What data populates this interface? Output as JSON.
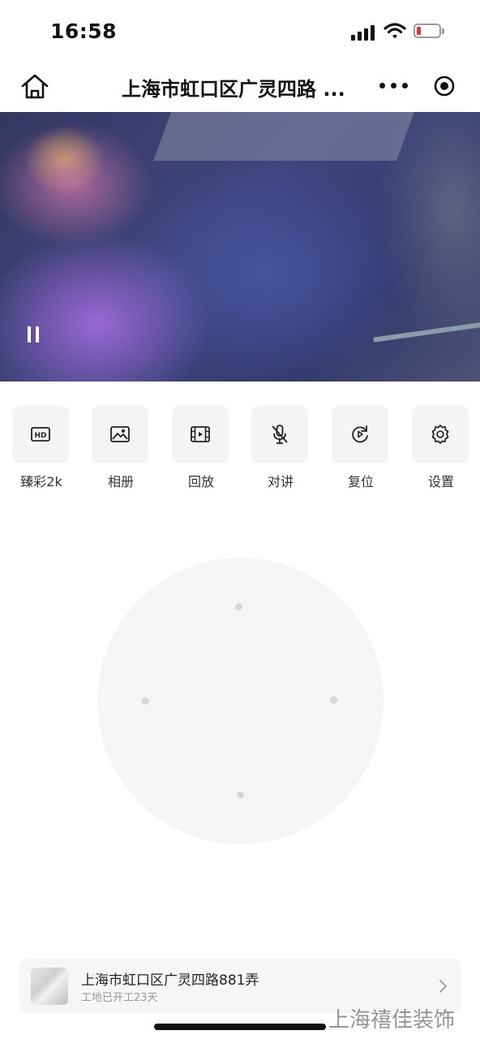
{
  "status_bar": {
    "time": "16:58",
    "icons": [
      "signal-icon",
      "wifi-icon",
      "battery-low-icon"
    ],
    "battery_color": "#e0363b"
  },
  "nav": {
    "title": "上海市虹口区广灵四路 ...",
    "icons": [
      "home-icon",
      "more-icon",
      "close-target-icon"
    ]
  },
  "video": {
    "paused": true,
    "icon": "pause-icon"
  },
  "toolbar": {
    "items": [
      {
        "label": "臻彩2k",
        "icon": "hd-icon"
      },
      {
        "label": "相册",
        "icon": "image-icon"
      },
      {
        "label": "回放",
        "icon": "film-icon"
      },
      {
        "label": "对讲",
        "icon": "mic-off-icon"
      },
      {
        "label": "复位",
        "icon": "reset-icon"
      },
      {
        "label": "设置",
        "icon": "gear-icon"
      }
    ]
  },
  "ptz": {
    "directions": [
      "up",
      "left",
      "right",
      "down"
    ]
  },
  "site": {
    "name": "上海市虹口区广灵四路881弄",
    "subtitle": "工地已开工23天",
    "icon": "chevron-right-icon"
  },
  "watermark": "上海禧佳装饰",
  "colors": {
    "background": "#ffffff",
    "button_bg": "#f4f4f4",
    "ptz_bg": "#f5f5f5"
  }
}
